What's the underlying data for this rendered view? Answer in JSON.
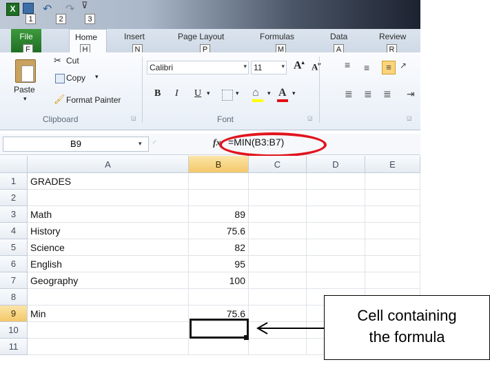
{
  "qat": {
    "keytips": [
      "1",
      "2",
      "3"
    ]
  },
  "tabs": [
    {
      "label": "File",
      "keytip": "F"
    },
    {
      "label": "Home",
      "keytip": "H"
    },
    {
      "label": "Insert",
      "keytip": "N"
    },
    {
      "label": "Page Layout",
      "keytip": "P"
    },
    {
      "label": "Formulas",
      "keytip": "M"
    },
    {
      "label": "Data",
      "keytip": "A"
    },
    {
      "label": "Review",
      "keytip": "R"
    }
  ],
  "clipboard": {
    "paste_label": "Paste",
    "cut_label": "Cut",
    "copy_label": "Copy",
    "format_painter_label": "Format Painter",
    "group_label": "Clipboard"
  },
  "font": {
    "font_name": "Calibri",
    "font_size": "11",
    "bold": "B",
    "italic": "I",
    "underline": "U",
    "group_label": "Font"
  },
  "formula_bar": {
    "name_box": "B9",
    "fx_label": "fx",
    "formula": "=MIN(B3:B7)"
  },
  "grid": {
    "columns": [
      "A",
      "B",
      "C",
      "D",
      "E"
    ],
    "rows": [
      {
        "n": "1",
        "a": "GRADES",
        "b": ""
      },
      {
        "n": "2",
        "a": "",
        "b": ""
      },
      {
        "n": "3",
        "a": "Math",
        "b": "89"
      },
      {
        "n": "4",
        "a": "History",
        "b": "75.6"
      },
      {
        "n": "5",
        "a": "Science",
        "b": "82"
      },
      {
        "n": "6",
        "a": "English",
        "b": "95"
      },
      {
        "n": "7",
        "a": "Geography",
        "b": "100"
      },
      {
        "n": "8",
        "a": "",
        "b": ""
      },
      {
        "n": "9",
        "a": "Min",
        "b": "75.6"
      },
      {
        "n": "10",
        "a": "",
        "b": ""
      },
      {
        "n": "11",
        "a": "",
        "b": ""
      }
    ],
    "selected_cell": "B9"
  },
  "callout": {
    "line1": "Cell containing",
    "line2": "the formula"
  },
  "colors": {
    "callout_highlight": "#e1141d",
    "file_tab": "#2a7f2f",
    "selected_header": "#f4c86a"
  }
}
